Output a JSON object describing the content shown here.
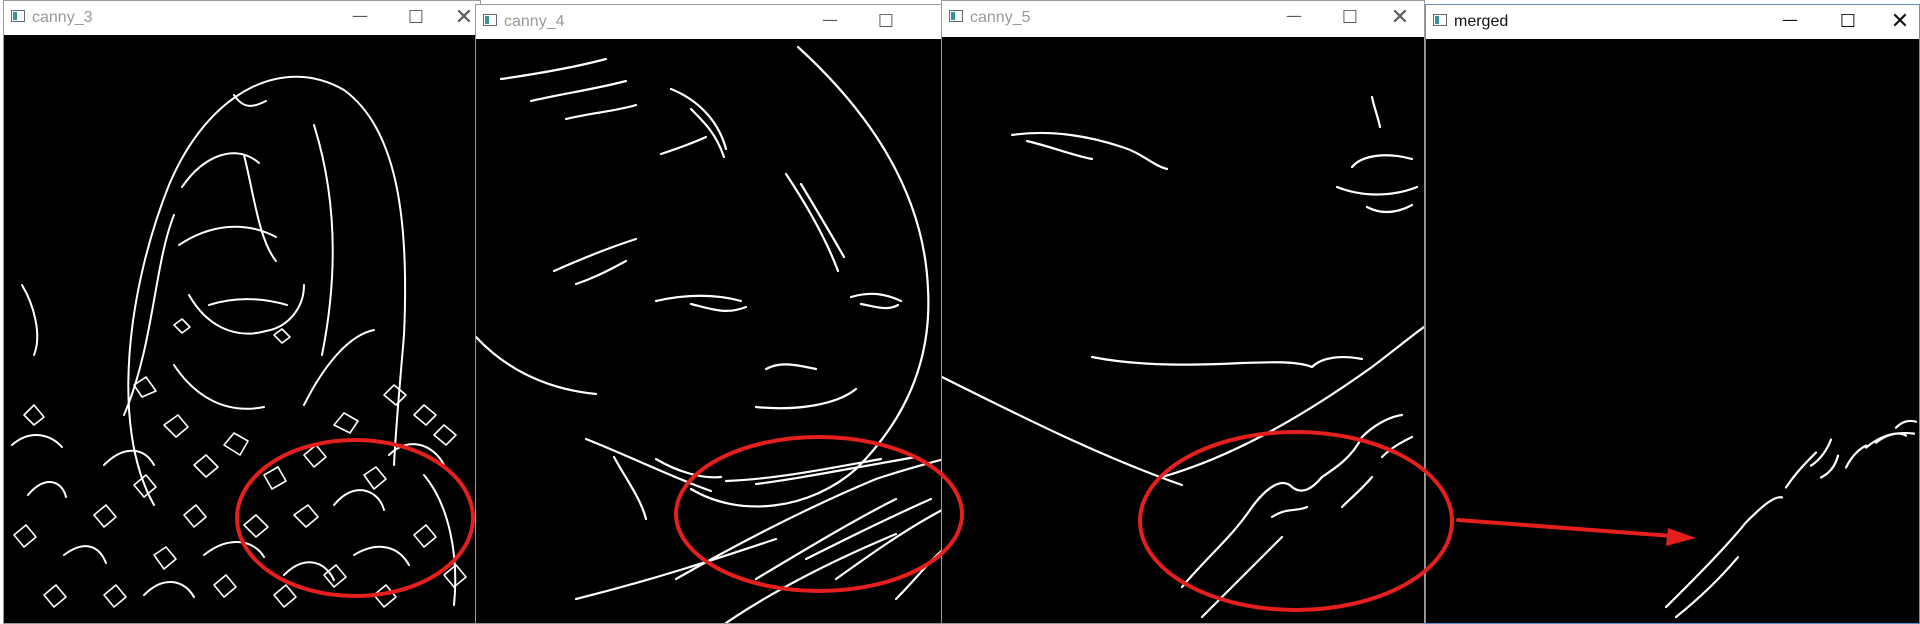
{
  "windows": [
    {
      "title": "canny_3",
      "controls": [
        "minimize-icon",
        "maximize-icon",
        "close-icon"
      ]
    },
    {
      "title": "canny_4",
      "controls": [
        "minimize-icon",
        "maximize-icon"
      ]
    },
    {
      "title": "canny_5",
      "controls": [
        "minimize-icon",
        "maximize-icon",
        "close-icon"
      ]
    },
    {
      "title": "merged",
      "controls": [
        "minimize-icon",
        "maximize-icon",
        "close-icon"
      ]
    }
  ],
  "annotations": {
    "circle_color": "#e51e1e",
    "arrow_color": "#e51e1e"
  },
  "colors": {
    "edge": "#ffffff",
    "background": "#000000",
    "active_border": "#5f93c8"
  }
}
